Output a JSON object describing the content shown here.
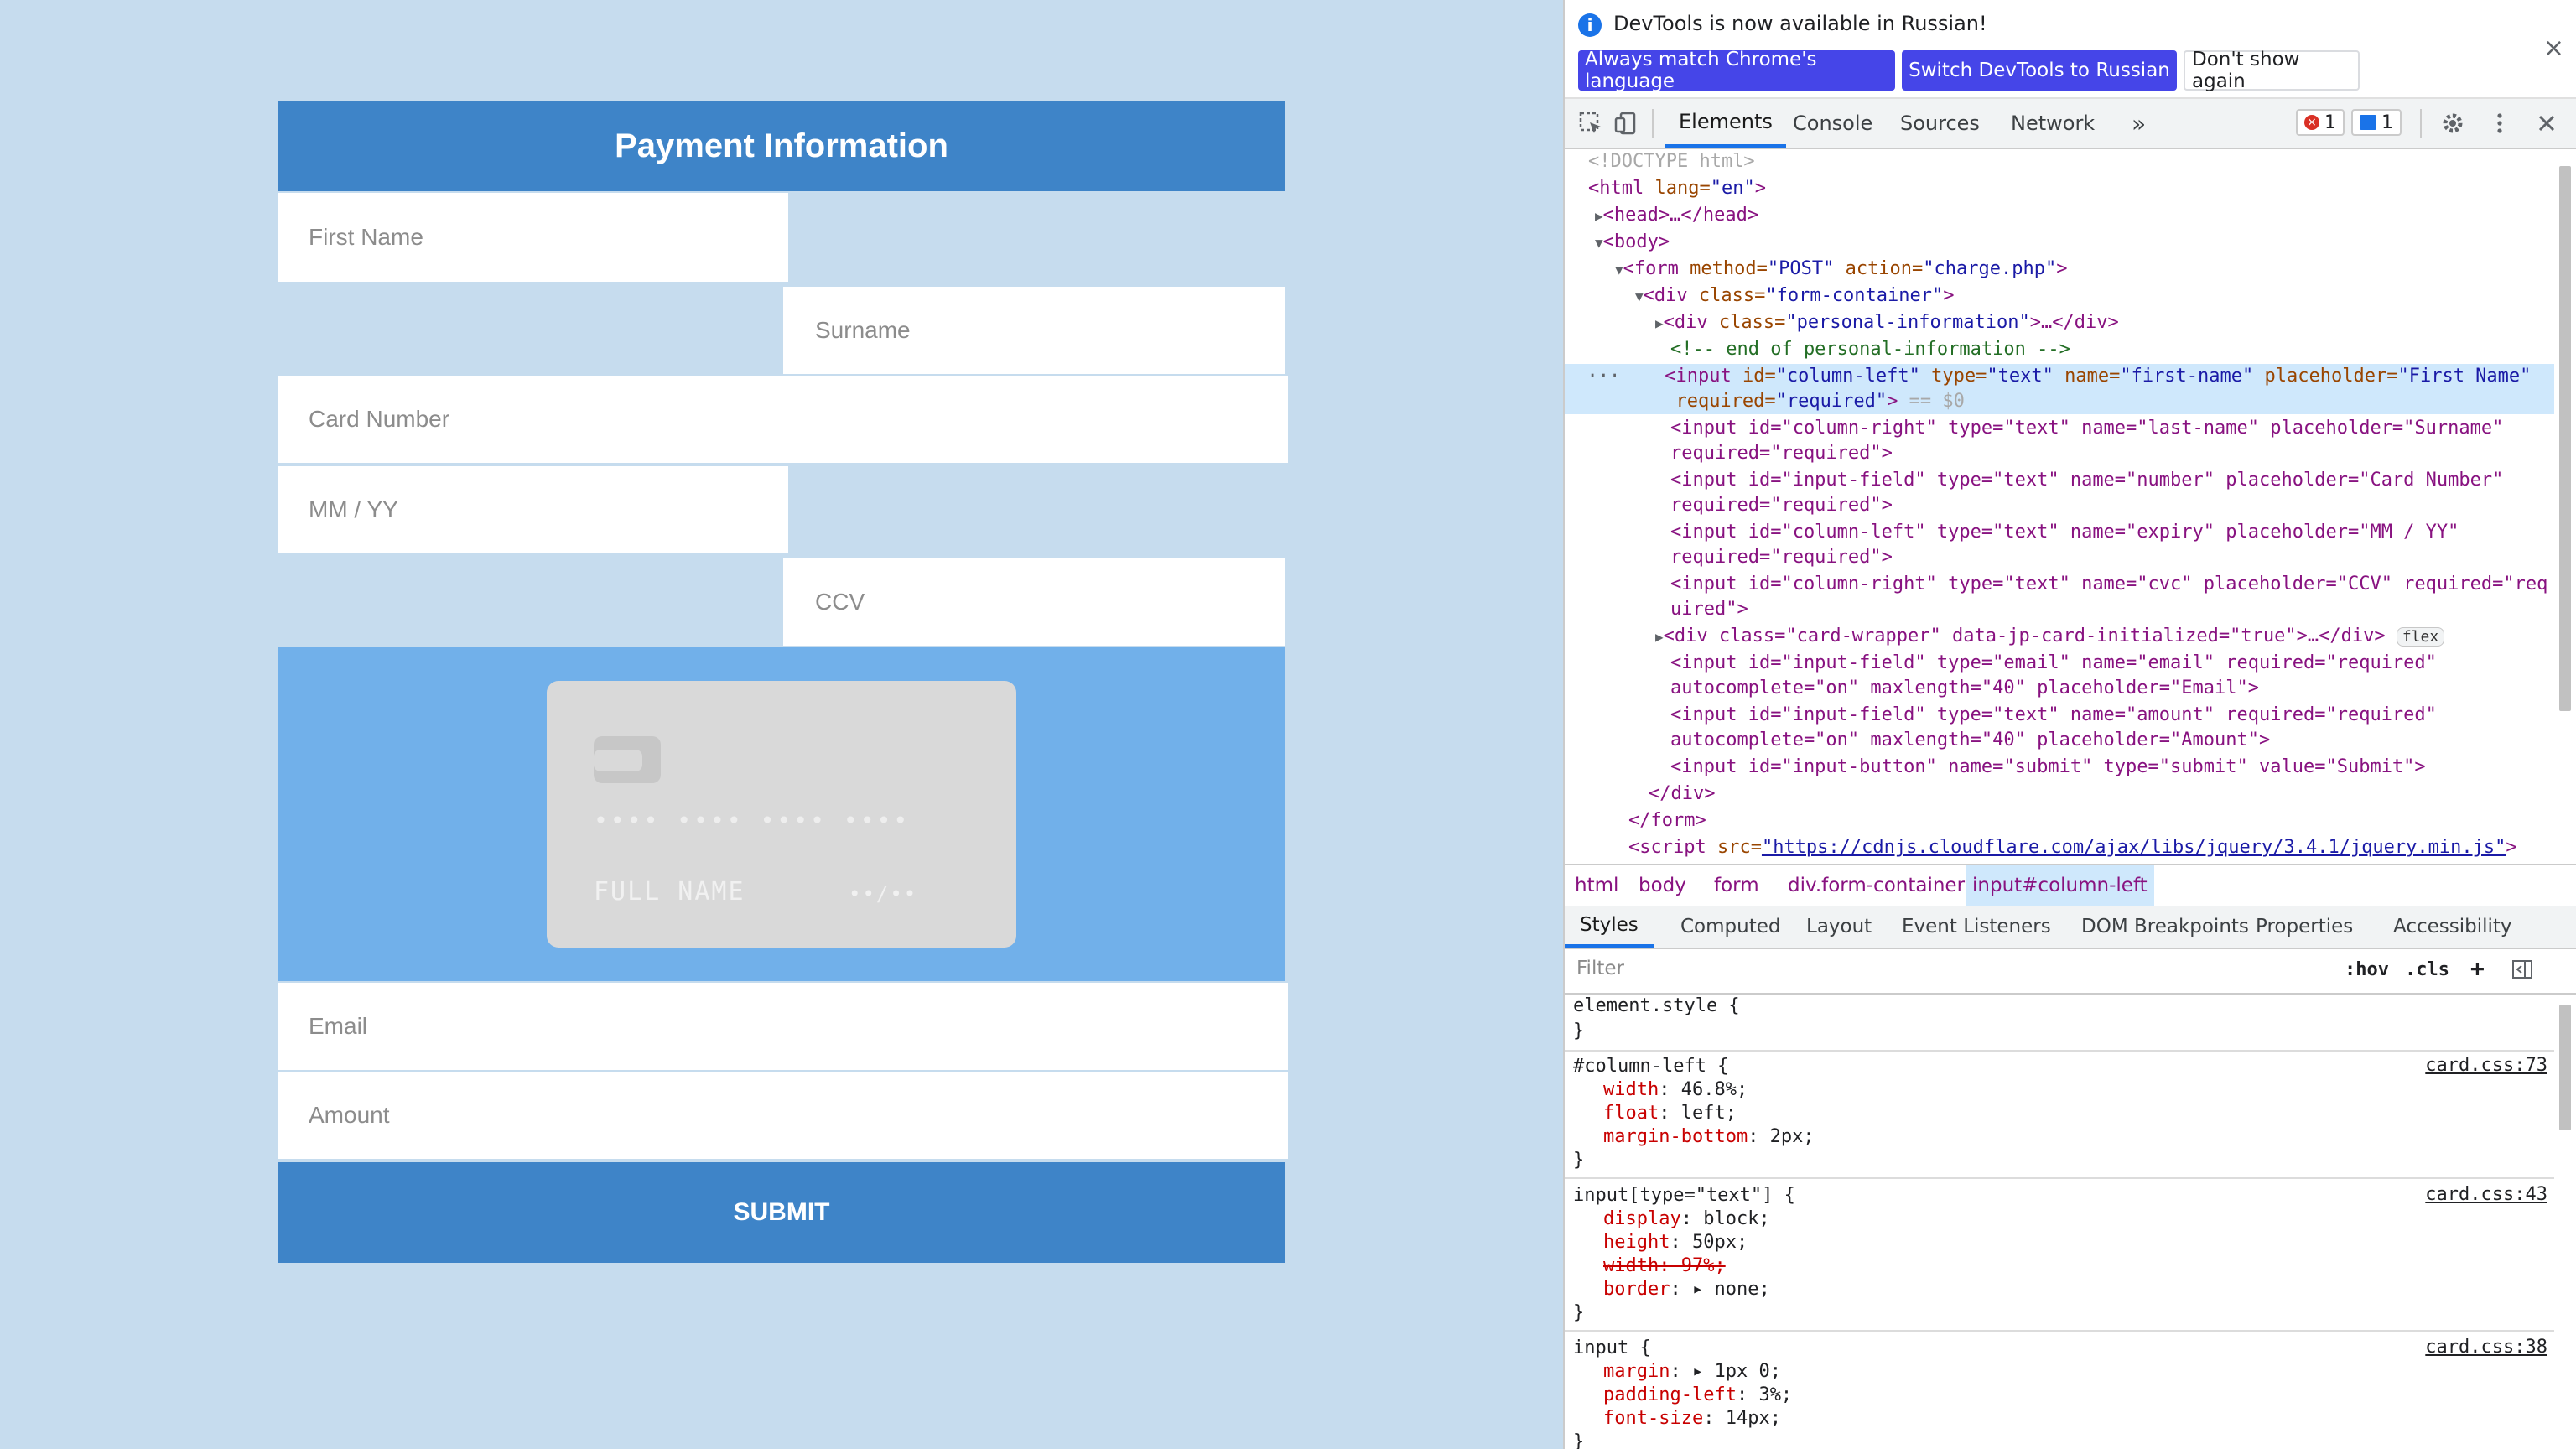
{
  "form": {
    "title": "Payment Information",
    "first_name_placeholder": "First Name",
    "surname_placeholder": "Surname",
    "card_number_placeholder": "Card Number",
    "expiry_placeholder": "MM / YY",
    "ccv_placeholder": "CCV",
    "email_placeholder": "Email",
    "amount_placeholder": "Amount",
    "submit_label": "SUBMIT",
    "card_preview": {
      "number": "•••• •••• •••• ••••",
      "name": "FULL NAME",
      "expiry": "••/••"
    }
  },
  "devtools": {
    "infobar": {
      "message": "DevTools is now available in Russian!",
      "btn_match": "Always match Chrome's language",
      "btn_switch": "Switch DevTools to Russian",
      "btn_dont": "Don't show again",
      "close": "×"
    },
    "tabs": [
      "Elements",
      "Console",
      "Sources",
      "Network"
    ],
    "more": "»",
    "errors_count": "1",
    "messages_count": "1",
    "breadcrumbs": [
      "html",
      "body",
      "form",
      "div.form-container",
      "input#column-left"
    ],
    "subtabs": [
      "Styles",
      "Computed",
      "Layout",
      "Event Listeners",
      "DOM Breakpoints",
      "Properties",
      "Accessibility"
    ],
    "filter_placeholder": "Filter",
    "hov": ":hov",
    "cls": ".cls",
    "dom": {
      "l0": "<!DOCTYPE html>",
      "l1_tag": "<html",
      "l1_attr": " lang=",
      "l1_val": "\"en\"",
      "l1_end": ">",
      "l2": "<head>…</head>",
      "l3": "<body>",
      "l4_tag": "<form",
      "l4_a1": " method=",
      "l4_v1": "\"POST\"",
      "l4_a2": " action=",
      "l4_v2": "\"charge.php\"",
      "l4_end": ">",
      "l5_tag": "<div",
      "l5_attr": " class=",
      "l5_val": "\"form-container\"",
      "l5_end": ">",
      "l6_tag": "<div",
      "l6_attr": " class=",
      "l6_val": "\"personal-information\"",
      "l6_end": ">…</div>",
      "l7": "<!-- end of personal-information -->",
      "l8a_tag": "<input",
      "l8a_rest_1": " id=",
      "l8a_v1": "\"column-left\"",
      "l8a_rest_2": " type=",
      "l8a_v2": "\"text\"",
      "l8a_rest_3": " name=",
      "l8a_v3": "\"first-name\"",
      "l8a_rest_4": " placeholder=",
      "l8a_v4": "\"First Name\"",
      "l8b_attr": "required=",
      "l8b_val": "\"required\"",
      "l8b_end": ">",
      "l8b_eq": " == $0",
      "l9a": "<input id=\"column-right\" type=\"text\" name=\"last-name\" placeholder=\"Surname\"",
      "l9b": "required=\"required\">",
      "l10a": "<input id=\"input-field\" type=\"text\" name=\"number\" placeholder=\"Card Number\"",
      "l10b": "required=\"required\">",
      "l11a": "<input id=\"column-left\" type=\"text\" name=\"expiry\" placeholder=\"MM / YY\"",
      "l11b": "required=\"required\">",
      "l12a": "<input id=\"column-right\" type=\"text\" name=\"cvc\" placeholder=\"CCV\" required=\"req",
      "l12b": "uired\">",
      "l13": "<div class=\"card-wrapper\" data-jp-card-initialized=\"true\">…</div>",
      "l13_pill": "flex",
      "l14a": "<input id=\"input-field\" type=\"email\" name=\"email\" required=\"required\"",
      "l14b": "autocomplete=\"on\" maxlength=\"40\" placeholder=\"Email\">",
      "l15a": "<input id=\"input-field\" type=\"text\" name=\"amount\" required=\"required\"",
      "l15b": "autocomplete=\"on\" maxlength=\"40\" placeholder=\"Amount\">",
      "l16": "<input id=\"input-button\" name=\"submit\" type=\"submit\" value=\"Submit\">",
      "l17": "</div>",
      "l18": "</form>",
      "l19_tag": "<script",
      "l19_attr": " src=",
      "l19_link": "\"https://cdnjs.cloudflare.com/ajax/libs/jquery/3.4.1/jquery.min.js\"",
      "l19_end": ">"
    },
    "styles": {
      "r0_sel": "element.style {",
      "close": "}",
      "r1_sel": "#column-left {",
      "r1_src": "card.css:73",
      "r1_p1": "width",
      "r1_v1": ": 46.8%;",
      "r1_p2": "float",
      "r1_v2": ": left;",
      "r1_p3": "margin-bottom",
      "r1_v3": ": 2px;",
      "r2_sel": "input[type=\"text\"] {",
      "r2_src": "card.css:43",
      "r2_p1": "display",
      "r2_v1": ": block;",
      "r2_p2": "height",
      "r2_v2": ": 50px;",
      "r2_strike": "width: 97%;",
      "r2_p4": "border",
      "r2_v4": ": ▸ none;",
      "r3_sel": "input {",
      "r3_src": "card.css:38",
      "r3_p1": "margin",
      "r3_v1": ": ▸ 1px 0;",
      "r3_p2": "padding-left",
      "r3_v2": ": 3%;",
      "r3_p3": "font-size",
      "r3_v3": ": 14px;"
    },
    "colors": {
      "accent": "#1a73e8",
      "primary_button": "#4545e8",
      "selected_row": "#cfe8fc"
    }
  }
}
